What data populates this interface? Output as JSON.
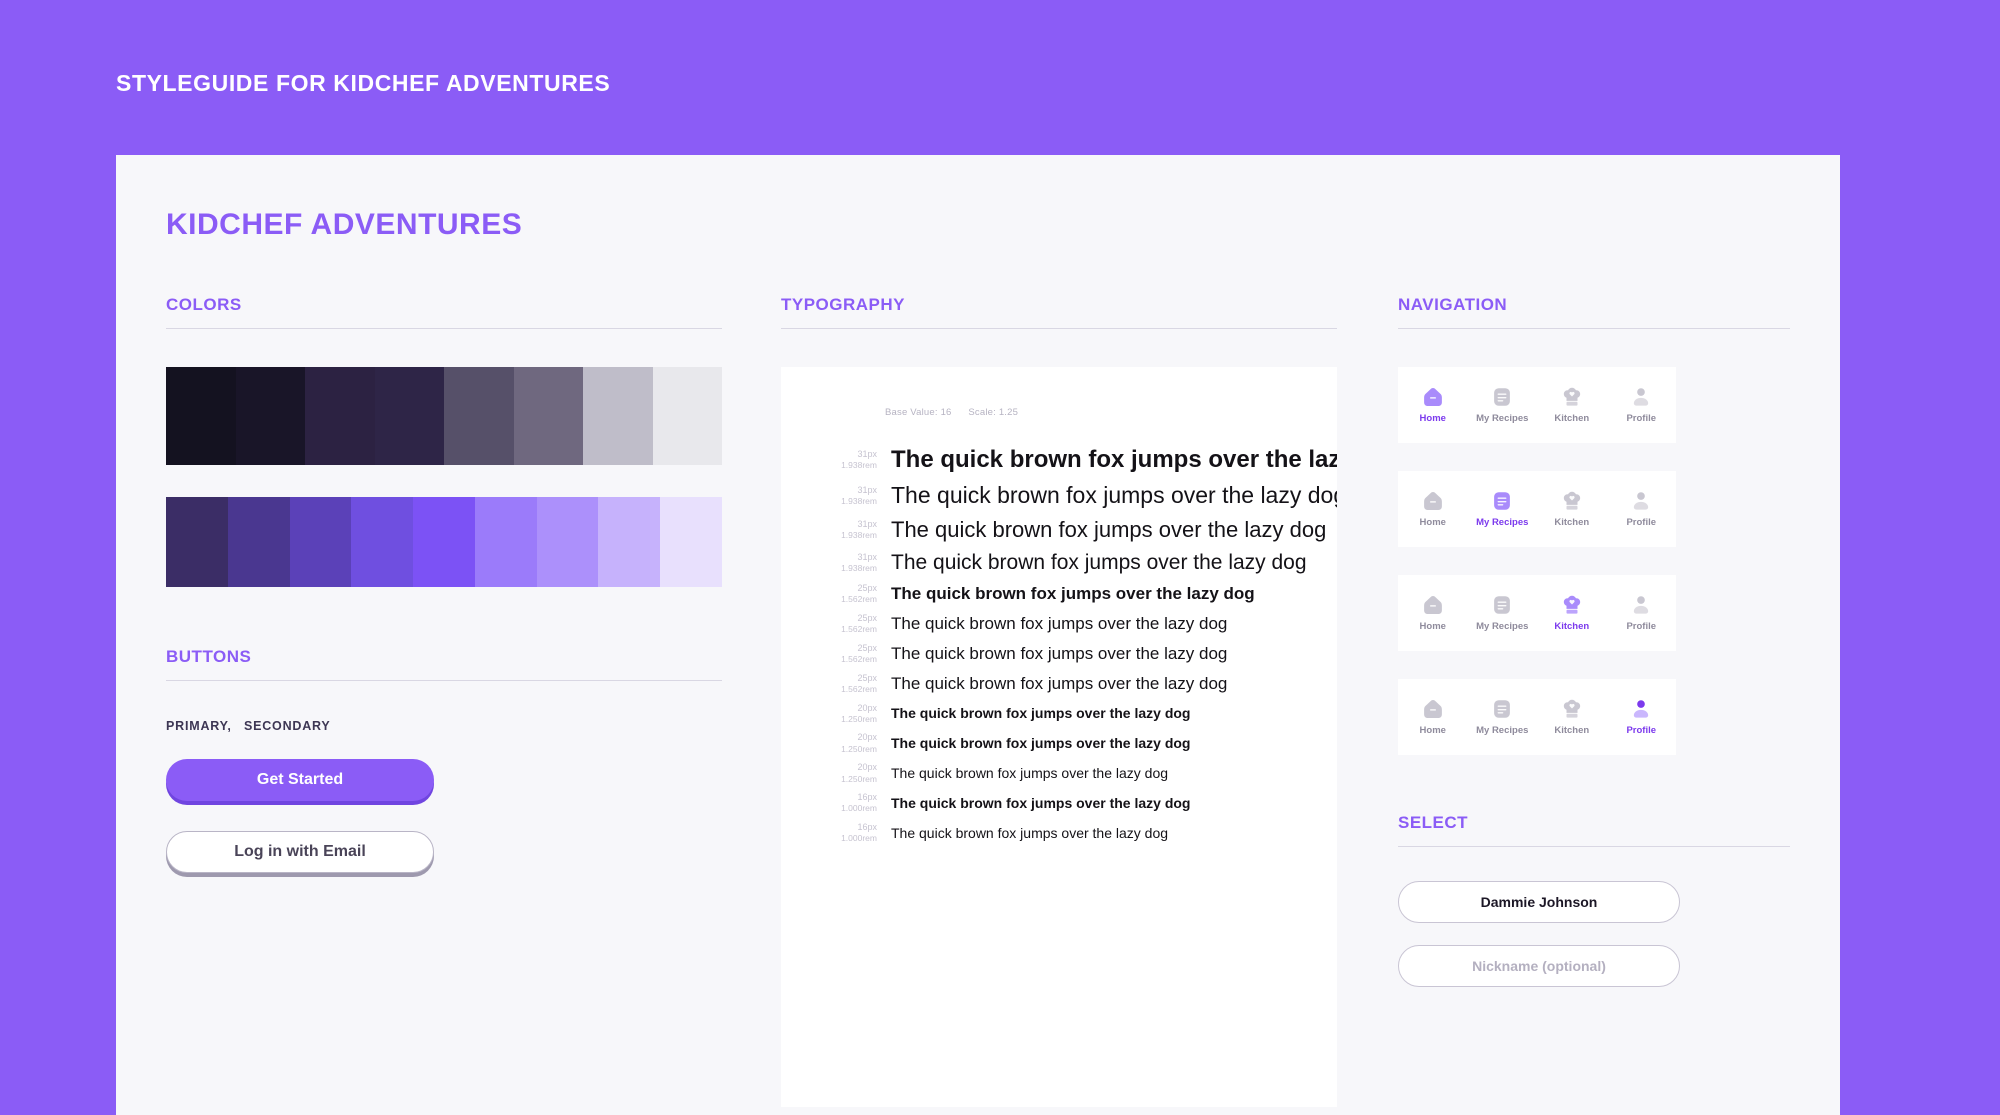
{
  "header": {
    "title": "STYLEGUIDE FOR KIDCHEF ADVENTURES"
  },
  "panel": {
    "title": "KIDCHEF ADVENTURES"
  },
  "colors": {
    "heading": "COLORS",
    "neutral_ramp": [
      "#141220",
      "#191528",
      "#2C2242",
      "#2E2547",
      "#565069",
      "#6F687F",
      "#BFBDC9",
      "#E8E8EC"
    ],
    "purple_ramp": [
      "#3B2D66",
      "#4A3790",
      "#5B41B8",
      "#6F4FE0",
      "#7C52F5",
      "#9B7BFA",
      "#AC90FB",
      "#C6B2FC",
      "#E8E0FD"
    ],
    "accent": "#8B5CF6",
    "page_background": "#8B5CF6",
    "panel_background": "#F7F7FA"
  },
  "buttons": {
    "heading": "BUTTONS",
    "variant_labels": [
      "PRIMARY,",
      "SECONDARY"
    ],
    "primary_label": "Get Started",
    "secondary_label": "Log in with Email"
  },
  "typography": {
    "heading": "TYPOGRAPHY",
    "base_value_label": "Base Value: 16",
    "scale_label": "Scale: 1.25",
    "sample_text": "The quick brown fox jumps over the lazy dog",
    "rows": [
      {
        "px": "31px",
        "rem": "1.938rem",
        "size": 24,
        "weight": 700
      },
      {
        "px": "31px",
        "rem": "1.938rem",
        "size": 23,
        "weight": 500
      },
      {
        "px": "31px",
        "rem": "1.938rem",
        "size": 22,
        "weight": 400
      },
      {
        "px": "31px",
        "rem": "1.938rem",
        "size": 21,
        "weight": 300
      },
      {
        "px": "25px",
        "rem": "1.562rem",
        "size": 17,
        "weight": 700
      },
      {
        "px": "25px",
        "rem": "1.562rem",
        "size": 17,
        "weight": 500
      },
      {
        "px": "25px",
        "rem": "1.562rem",
        "size": 17,
        "weight": 400
      },
      {
        "px": "25px",
        "rem": "1.562rem",
        "size": 17,
        "weight": 300
      },
      {
        "px": "20px",
        "rem": "1.250rem",
        "size": 14,
        "weight": 700
      },
      {
        "px": "20px",
        "rem": "1.250rem",
        "size": 14,
        "weight": 700
      },
      {
        "px": "20px",
        "rem": "1.250rem",
        "size": 14,
        "weight": 400
      },
      {
        "px": "16px",
        "rem": "1.000rem",
        "size": 14,
        "weight": 700
      },
      {
        "px": "16px",
        "rem": "1.000rem",
        "size": 14,
        "weight": 400
      }
    ]
  },
  "navigation": {
    "heading": "NAVIGATION",
    "items": [
      {
        "label": "Home",
        "icon": "home-icon"
      },
      {
        "label": "My Recipes",
        "icon": "recipes-icon"
      },
      {
        "label": "Kitchen",
        "icon": "chef-hat-icon"
      },
      {
        "label": "Profile",
        "icon": "profile-icon"
      }
    ],
    "bars": [
      {
        "active": 0
      },
      {
        "active": 1
      },
      {
        "active": 2
      },
      {
        "active": 3
      }
    ],
    "active_color": "#7C3AED",
    "inactive_color": "#C9C7D1"
  },
  "select": {
    "heading": "SELECT",
    "value": "Dammie Johnson",
    "placeholder": "Nickname (optional)"
  }
}
